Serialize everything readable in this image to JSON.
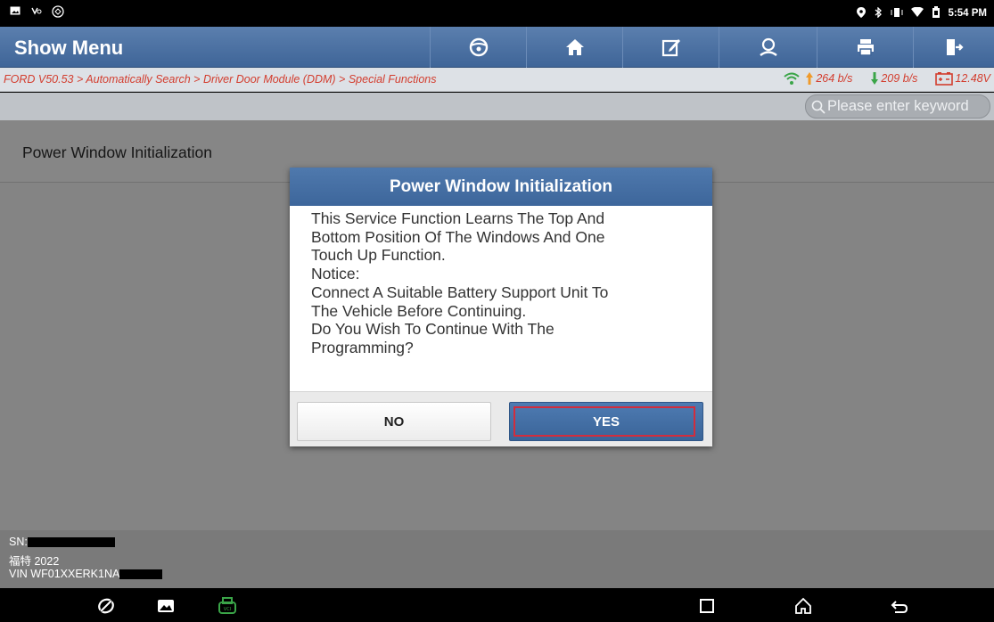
{
  "status_bar": {
    "time": "5:54 PM",
    "left_icons": [
      "gallery-icon",
      "voicemail-icon",
      "vci-icon"
    ],
    "right_icons": [
      "location-icon",
      "bluetooth-icon",
      "vibrate-icon",
      "wifi-icon",
      "battery-icon"
    ]
  },
  "app_bar": {
    "title": "Show Menu",
    "tools": [
      "steering-wheel-icon",
      "home-icon",
      "edit-icon",
      "user-icon",
      "print-icon",
      "exit-icon"
    ]
  },
  "breadcrumb": {
    "path": "FORD V50.53 > Automatically Search > Driver Door Module (DDM) > Special Functions",
    "upload": "264 b/s",
    "download": "209 b/s",
    "voltage": "12.48V"
  },
  "search": {
    "placeholder": "Please enter keyword"
  },
  "menu": {
    "items": [
      {
        "label": "Power Window Initialization"
      }
    ]
  },
  "dialog": {
    "title": "Power Window Initialization",
    "lines": [
      "This Service Function Learns The Top And",
      "Bottom Position Of The Windows And One",
      "Touch Up Function.",
      "Notice:",
      "Connect A Suitable Battery Support Unit To",
      "The Vehicle Before Continuing.",
      "Do You Wish To Continue With The",
      "Programming?"
    ],
    "no_label": "NO",
    "yes_label": "YES"
  },
  "vehicle_info": {
    "sn_label": "SN:",
    "model": "福特  2022",
    "vin_label": "VIN WF01XXERK1NA"
  },
  "colors": {
    "accent": "#3f6598",
    "crumb_text": "#d33d2e",
    "highlight": "#d22d3d"
  }
}
